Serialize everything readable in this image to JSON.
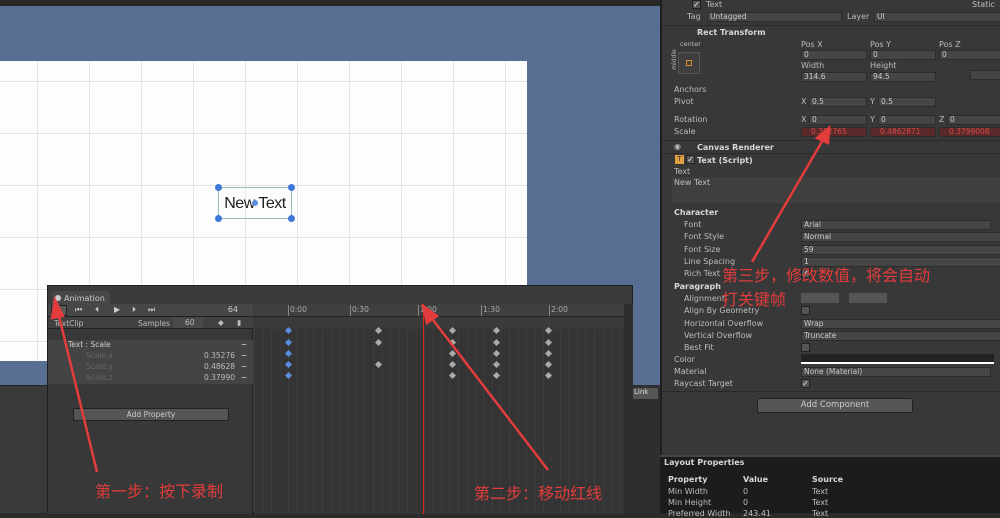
{
  "scene": {
    "text_object": "New Text"
  },
  "animation": {
    "tab_label": "Animation",
    "frame": "64",
    "clip": "TextClip",
    "samples_label": "Samples",
    "samples": "60",
    "ruler": [
      "0:00",
      "0:30",
      "1:00",
      "1:30",
      "2:00"
    ],
    "properties": [
      {
        "name": "Text : Scale",
        "value": ""
      },
      {
        "name": "Scale.x",
        "value": "0.35276"
      },
      {
        "name": "Scale.y",
        "value": "0.48628"
      },
      {
        "name": "Scale.z",
        "value": "0.37990"
      }
    ],
    "add_property": "Add Property",
    "link": "Link"
  },
  "inspector": {
    "object_name": "Text",
    "static_label": "Static",
    "tag_label": "Tag",
    "tag": "Untagged",
    "layer_label": "Layer",
    "layer": "UI",
    "rect_transform": {
      "title": "Rect Transform",
      "anchor_h": "center",
      "anchor_v": "middle",
      "pos_x_label": "Pos X",
      "pos_y_label": "Pos Y",
      "pos_z_label": "Pos Z",
      "pos_x": "0",
      "pos_y": "0",
      "pos_z": "0",
      "width_label": "Width",
      "height_label": "Height",
      "width": "314.6",
      "height": "94.5",
      "anchors": "Anchors",
      "pivot": "Pivot",
      "pivot_x": "0.5",
      "pivot_y": "0.5",
      "rotation": "Rotation",
      "rot_x": "0",
      "rot_y": "0",
      "rot_z": "0",
      "scale": "Scale",
      "scale_x": "0.352765",
      "scale_y": "0.4862871",
      "scale_z": "0.3799008"
    },
    "canvas_renderer": "Canvas Renderer",
    "text_script": {
      "title": "Text (Script)",
      "text_label": "Text",
      "text_value": "New Text",
      "character": "Character",
      "font_label": "Font",
      "font": "Arial",
      "font_style_label": "Font Style",
      "font_style": "Normal",
      "font_size_label": "Font Size",
      "font_size": "59",
      "line_spacing_label": "Line Spacing",
      "line_spacing": "1",
      "rich_text": "Rich Text",
      "paragraph": "Paragraph",
      "alignment": "Alignment",
      "align_geometry": "Align By Geometry",
      "h_overflow_label": "Horizontal Overflow",
      "h_overflow": "Wrap",
      "v_overflow_label": "Vertical Overflow",
      "v_overflow": "Truncate",
      "best_fit": "Best Fit",
      "color": "Color",
      "material_label": "Material",
      "material": "None (Material)",
      "raycast": "Raycast Target"
    },
    "add_component": "Add Component"
  },
  "layout_properties": {
    "title": "Layout Properties",
    "headers": [
      "Property",
      "Value",
      "Source"
    ],
    "rows": [
      [
        "Min Width",
        "0",
        "Text"
      ],
      [
        "Min Height",
        "0",
        "Text"
      ],
      [
        "Preferred Width",
        "243.41",
        "Text"
      ]
    ]
  },
  "annotations": {
    "step1": "第一步：按下录制",
    "step2": "第二步：移动红线",
    "step3_line1": "第三步，修改数值，将会自动",
    "step3_line2": "打关键帧"
  },
  "colors": {
    "annotation": "#e23c3c",
    "scene_bg": "#586e92",
    "keyframe_selected": "#5a8de0",
    "playhead": "#dd2222"
  }
}
